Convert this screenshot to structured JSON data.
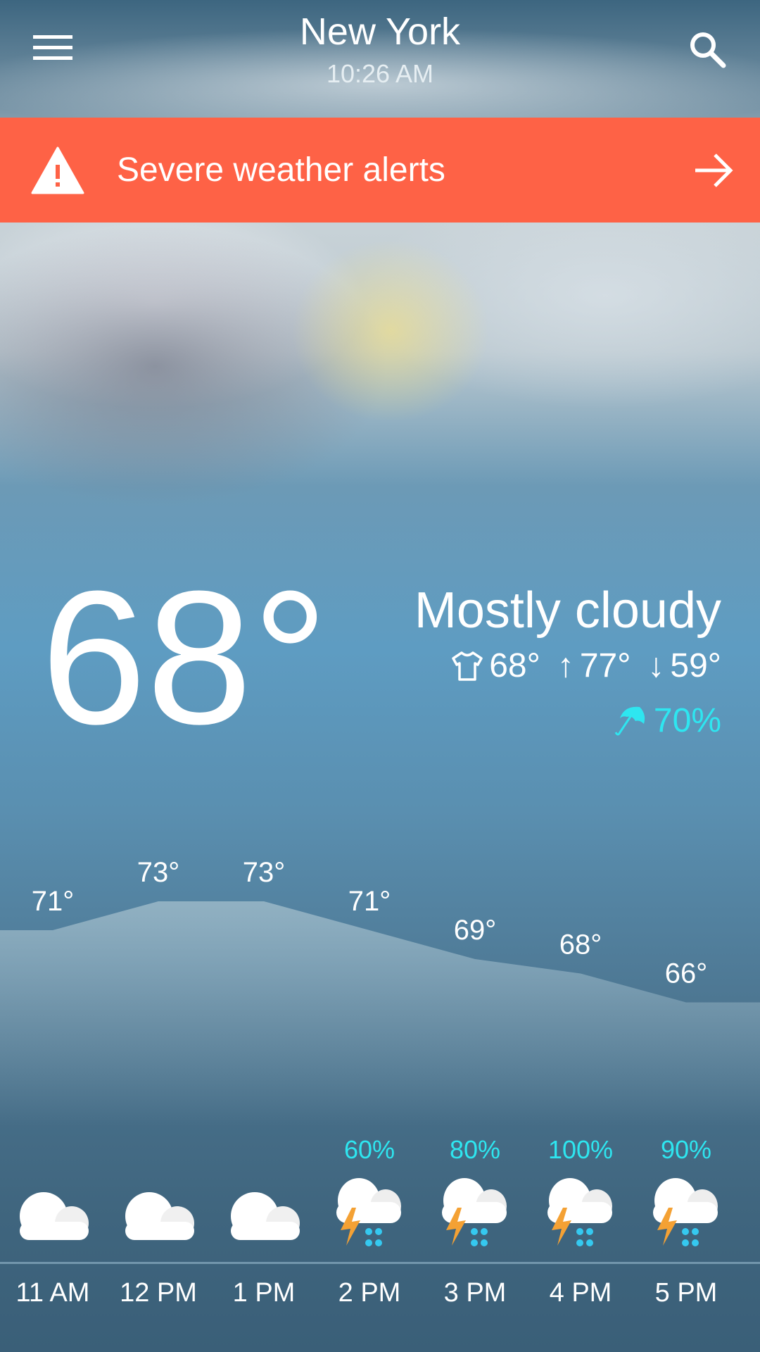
{
  "header": {
    "city": "New York",
    "time": "10:26 AM"
  },
  "alert": {
    "label": "Severe weather alerts",
    "color": "#fe6246"
  },
  "current": {
    "temp": "68°",
    "condition": "Mostly cloudy",
    "feels_like": "68°",
    "high": "77°",
    "low": "59°",
    "precip": "70%"
  },
  "hourly": [
    {
      "hour": "11 AM",
      "temp": 71,
      "temp_label": "71°",
      "precip": "",
      "icon": "cloudy-icon"
    },
    {
      "hour": "12 PM",
      "temp": 73,
      "temp_label": "73°",
      "precip": "",
      "icon": "cloudy-icon"
    },
    {
      "hour": "1 PM",
      "temp": 73,
      "temp_label": "73°",
      "precip": "",
      "icon": "cloudy-icon"
    },
    {
      "hour": "2 PM",
      "temp": 71,
      "temp_label": "71°",
      "precip": "60%",
      "icon": "thunderstorm-icon"
    },
    {
      "hour": "3 PM",
      "temp": 69,
      "temp_label": "69°",
      "precip": "80%",
      "icon": "thunderstorm-icon"
    },
    {
      "hour": "4 PM",
      "temp": 68,
      "temp_label": "68°",
      "precip": "100%",
      "icon": "thunderstorm-icon"
    },
    {
      "hour": "5 PM",
      "temp": 66,
      "temp_label": "66°",
      "precip": "90%",
      "icon": "thunderstorm-icon"
    }
  ],
  "colors": {
    "precip": "#2ee6f0",
    "lightning": "#f4a134",
    "rain_drops": "#35c9f0"
  }
}
